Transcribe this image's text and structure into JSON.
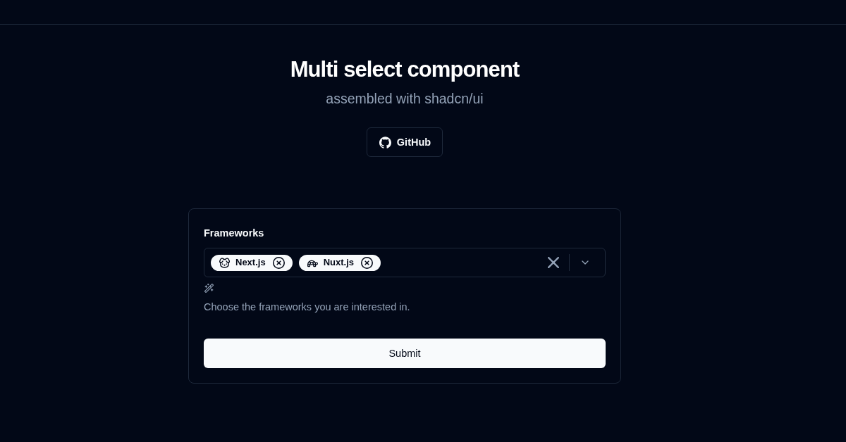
{
  "hero": {
    "title": "Multi select component",
    "subtitle": "assembled with shadcn/ui",
    "github_button": {
      "label": "GitHub"
    }
  },
  "form": {
    "field_label": "Frameworks",
    "multi_select": {
      "selected": [
        {
          "label": "Next.js",
          "kind": "dog"
        },
        {
          "label": "Nuxt.js",
          "kind": "turtle"
        }
      ]
    },
    "description": "Choose the frameworks you are interested in.",
    "submit_button": {
      "label": "Submit"
    }
  }
}
